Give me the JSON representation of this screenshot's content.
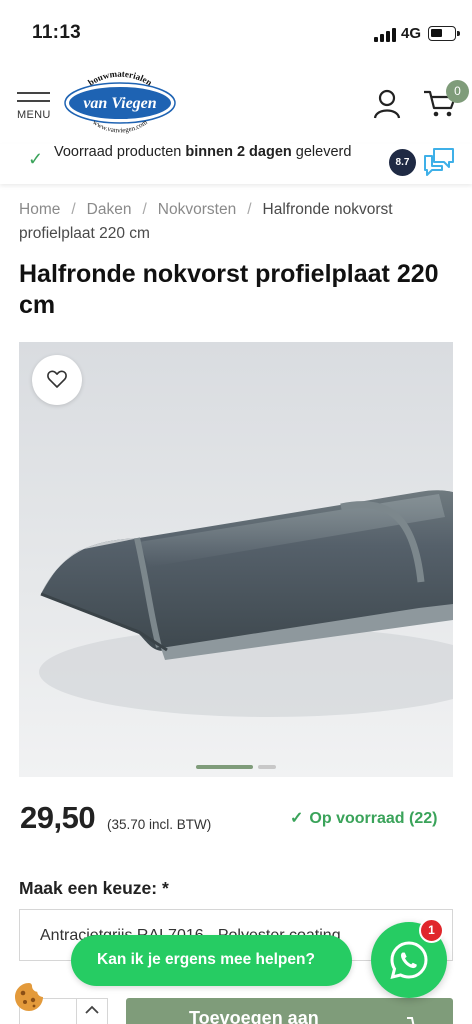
{
  "status_bar": {
    "time": "11:13",
    "network": "4G"
  },
  "header": {
    "menu_label": "MENU",
    "logo": {
      "top_text": "bouwmaterialen",
      "name": "van Viegen",
      "url": "www.vanviegen.com"
    },
    "cart_count": "0"
  },
  "usp": {
    "text_before": "Voorraad producten ",
    "text_bold": "binnen 2 dagen",
    "text_after": " geleverd",
    "rating": "8.7"
  },
  "breadcrumb": {
    "items": [
      "Home",
      "Daken",
      "Nokvorsten"
    ],
    "separator": "/",
    "current": "Halfronde nokvorst profielplaat 220 cm"
  },
  "product": {
    "title": "Halfronde nokvorst profielplaat 220 cm",
    "price": "29,50",
    "price_incl": "(35.70 incl. BTW)",
    "stock_text": "Op voorraad (22)",
    "image_count": 2,
    "active_image": 1
  },
  "options": {
    "label": "Maak een keuze: *",
    "selected": "Antracietgrijs RAL7016 - Polyester coating"
  },
  "purchase": {
    "add_button": "Toevoegen aan"
  },
  "chat": {
    "bubble_text": "Kan ik je ergens mee helpen?",
    "badge_count": "1"
  },
  "colors": {
    "accent_green": "#7f9c7a",
    "whatsapp_green": "#26cc63",
    "stock_green": "#3aa35a",
    "badge_red": "#e0262b",
    "rating_navy": "#1f2a44"
  },
  "icons": [
    "hamburger-icon",
    "user-icon",
    "cart-icon",
    "check-icon",
    "review-icon",
    "heart-icon",
    "whatsapp-icon",
    "cookie-icon",
    "chevron-up-icon"
  ]
}
